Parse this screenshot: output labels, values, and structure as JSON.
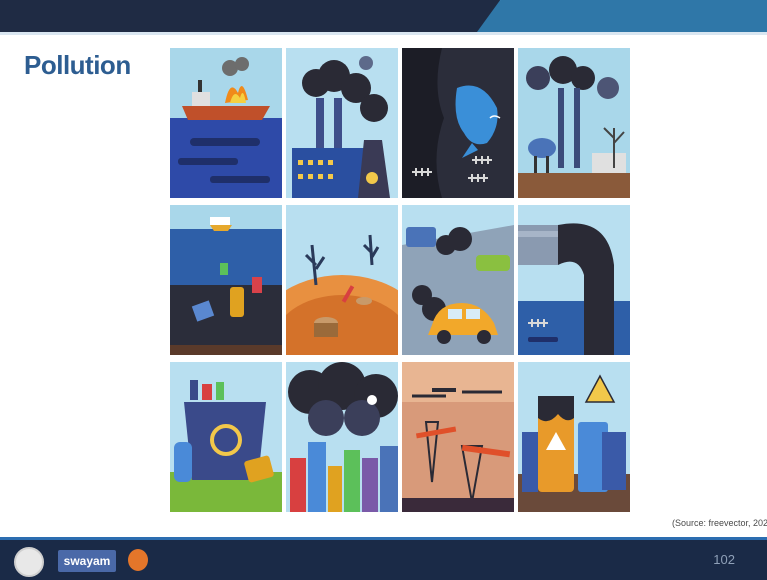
{
  "slide": {
    "title": "Pollution",
    "source": "(Source: freevector, 202",
    "page_number": "102"
  },
  "footer": {
    "logo_text": "swayam"
  },
  "tiles": [
    {
      "name": "oil-spill-ship"
    },
    {
      "name": "factory-smoke"
    },
    {
      "name": "dolphin-polluted-water"
    },
    {
      "name": "chemical-plant"
    },
    {
      "name": "ocean-trash"
    },
    {
      "name": "deforestation"
    },
    {
      "name": "car-exhaust"
    },
    {
      "name": "sewage-pipe"
    },
    {
      "name": "trash-bin"
    },
    {
      "name": "toxic-cloud-city"
    },
    {
      "name": "oil-pumps"
    },
    {
      "name": "toxic-barrels"
    }
  ]
}
